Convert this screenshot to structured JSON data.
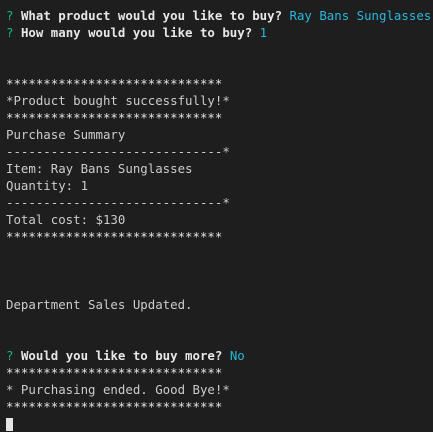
{
  "prompt1": {
    "mark": "?",
    "question": "What product would you like to buy?",
    "answer": "Ray Bans Sunglasses"
  },
  "prompt2": {
    "mark": "?",
    "question": "How many would you like to buy?",
    "answer": "1"
  },
  "stars_line": "*****************************",
  "success_message": "*Product bought successfully!*",
  "summary_title": "Purchase Summary",
  "dash_line": "-----------------------------*",
  "item_line": "Item: Ray Bans Sunglasses",
  "quantity_line": "Quantity: 1",
  "total_line": "Total cost: $130",
  "dept_update": "Department Sales Updated.",
  "prompt3": {
    "mark": "?",
    "question": "Would you like to buy more?",
    "answer": "No"
  },
  "goodbye_message": "* Purchasing ended. Good Bye!*"
}
